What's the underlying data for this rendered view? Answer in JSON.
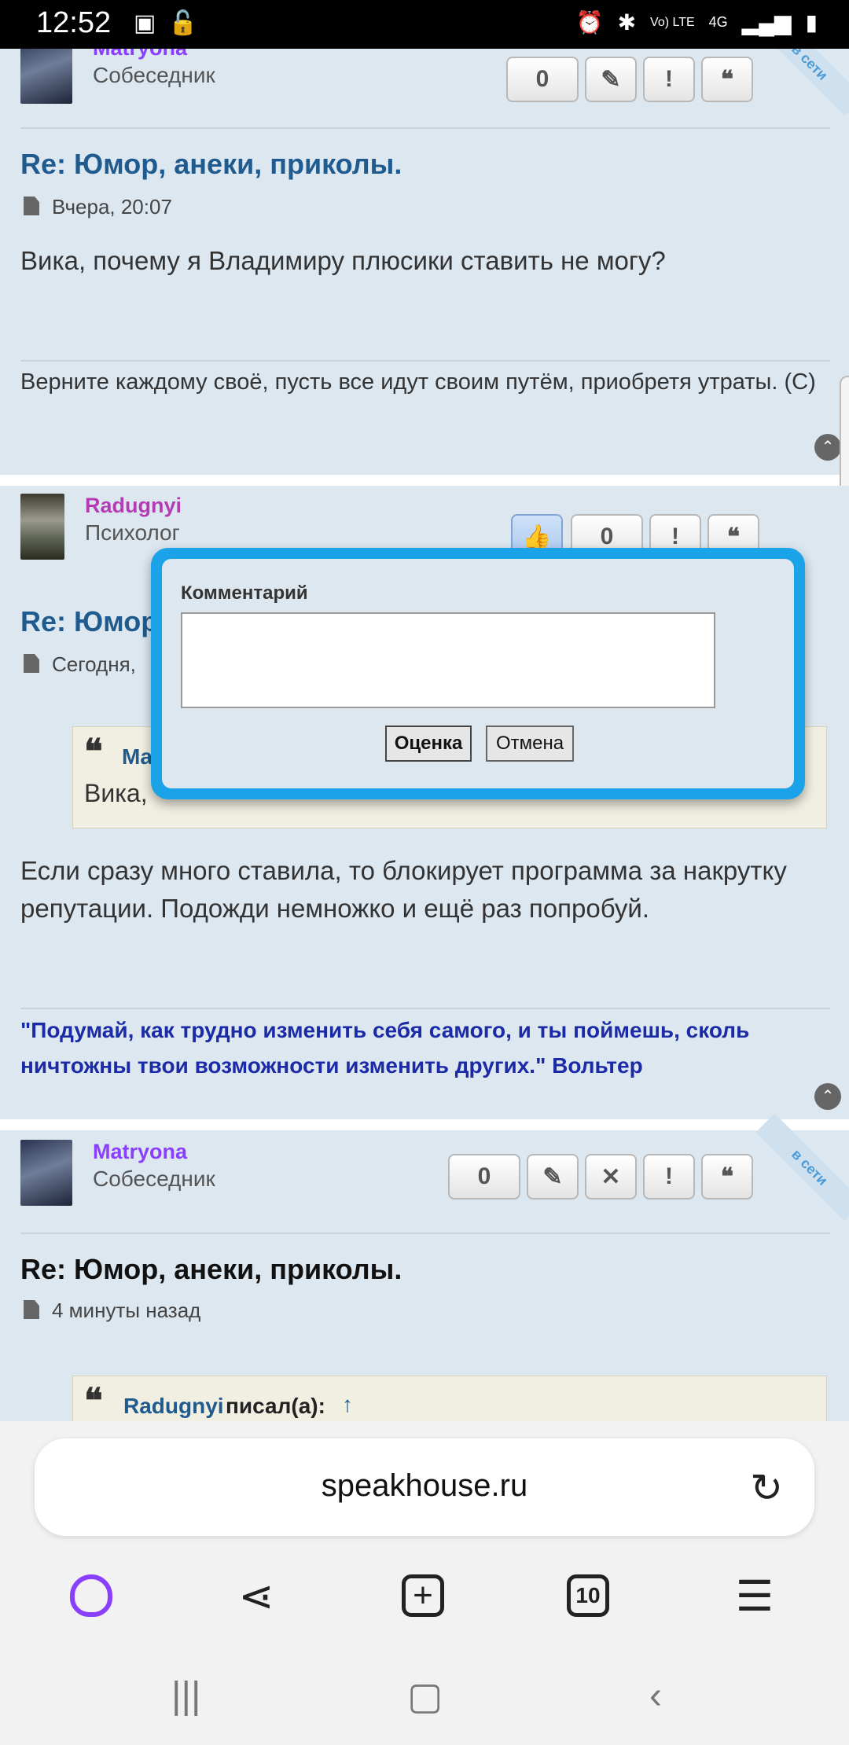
{
  "status_bar": {
    "time": "12:52",
    "lte": "Vo) LTE",
    "net": "4G"
  },
  "post1": {
    "username": "Matryona",
    "role": "Собеседник",
    "rating": "0",
    "ribbon": "в сети",
    "title": "Re: Юмор, анеки, приколы.",
    "date": "Вчера, 20:07",
    "text": "Вика, почему я Владимиру плюсики ставить не могу?",
    "signature": "Верните каждому своё, пусть все идут своим путём, приобретя утраты. (С)"
  },
  "post2": {
    "username": "Radugnyi",
    "role": "Психолог",
    "rating": "0",
    "title": "Re: Юмор",
    "date": "Сегодня,",
    "quote_author": "Ma",
    "quote_text": "Вика,",
    "text": "Если сразу много ставила, то блокирует программа за накрутку репутации. Подожди немножко и ещё раз попробуй.",
    "signature": "\"Подумай, как трудно изменить себя самого, и ты поймешь, сколь ничтожны твои возможности изменить других.\" Вольтер"
  },
  "post3": {
    "username": "Matryona",
    "role": "Собеседник",
    "rating": "0",
    "ribbon": "в сети",
    "title": "Re: Юмор, анеки, приколы.",
    "date": "4 минуты назад",
    "quote_author": "Radugnyi",
    "quote_suffix": "писал(а):",
    "quote_arrow": "↑"
  },
  "modal": {
    "label": "Комментарий",
    "comment_value": "",
    "submit_label": "Оценка",
    "cancel_label": "Отмена"
  },
  "browser": {
    "url": "speakhouse.ru",
    "tab_count": "10"
  },
  "colors": {
    "accent": "#1aa3e8",
    "link": "#1f5b8f",
    "username_matryona": "#8a3ffc",
    "username_radugnyi": "#b53bb5"
  }
}
